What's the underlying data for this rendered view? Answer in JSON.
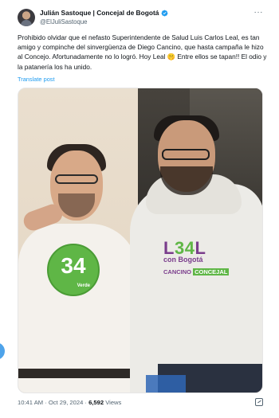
{
  "tweet": {
    "author": {
      "display_name": "Julián Sastoque | Concejal de Bogotá",
      "handle": "@ElJuliSastoque",
      "verified": true
    },
    "text": "Prohibido olvidar que el nefasto Superintendente de Salud Luis Carlos Leal, es tan amigo y compinche del sinvergüenza de Diego Cancino, que hasta campaña le hizo al Concejo. Afortunadamente no lo logró. Hoy Leal 🤫 Entre ellos se tapan!! El odio y la patanería los ha unido.",
    "translate_label": "Translate post",
    "timestamp": "10:41 AM · Oct 29, 2024 · ",
    "views_count": "6,592",
    "views_label": " Views"
  },
  "media": {
    "badge_number": "34",
    "badge_sub": "Verde",
    "hoodie_logo_main_left": "L",
    "hoodie_logo_main_green": "34",
    "hoodie_logo_main_right": "L",
    "hoodie_logo_sub": "con Bogotá",
    "hoodie_logo_bottom_left": "CANCINO ",
    "hoodie_logo_bottom_highlight": "CONCEJAL"
  },
  "colors": {
    "link": "#1d9bf0",
    "secondary_text": "#536471",
    "badge_green": "#5fb646",
    "logo_purple": "#7a3d8c"
  },
  "icons": [
    "avatar",
    "verified-badge-icon",
    "more-icon",
    "grok-icon"
  ]
}
